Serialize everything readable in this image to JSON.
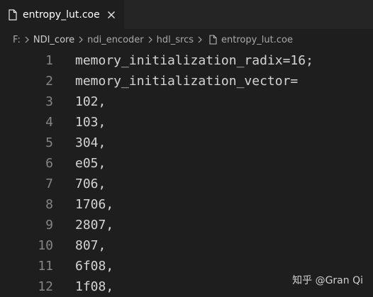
{
  "tab": {
    "label": "entropy_lut.coe",
    "icon": "file-icon",
    "close_icon": "close-icon"
  },
  "breadcrumb": {
    "items": [
      "F:",
      "NDI_core",
      "ndi_encoder",
      "hdl_srcs",
      "entropy_lut.coe"
    ]
  },
  "editor": {
    "lines": [
      {
        "num": "1",
        "text": "memory_initialization_radix=16;"
      },
      {
        "num": "2",
        "text": "memory_initialization_vector="
      },
      {
        "num": "3",
        "text": "102,"
      },
      {
        "num": "4",
        "text": "103,"
      },
      {
        "num": "5",
        "text": "304,"
      },
      {
        "num": "6",
        "text": "e05,"
      },
      {
        "num": "7",
        "text": "706,"
      },
      {
        "num": "8",
        "text": "1706,"
      },
      {
        "num": "9",
        "text": "2807,"
      },
      {
        "num": "10",
        "text": "807,"
      },
      {
        "num": "11",
        "text": "6f08,"
      },
      {
        "num": "12",
        "text": "1f08,"
      }
    ]
  },
  "watermark": {
    "text": "知乎 @Gran Qi"
  },
  "colors": {
    "background": "#1e1e1e",
    "tabbar": "#252526",
    "line_number": "#858585",
    "code_text": "#d4d4d4"
  }
}
